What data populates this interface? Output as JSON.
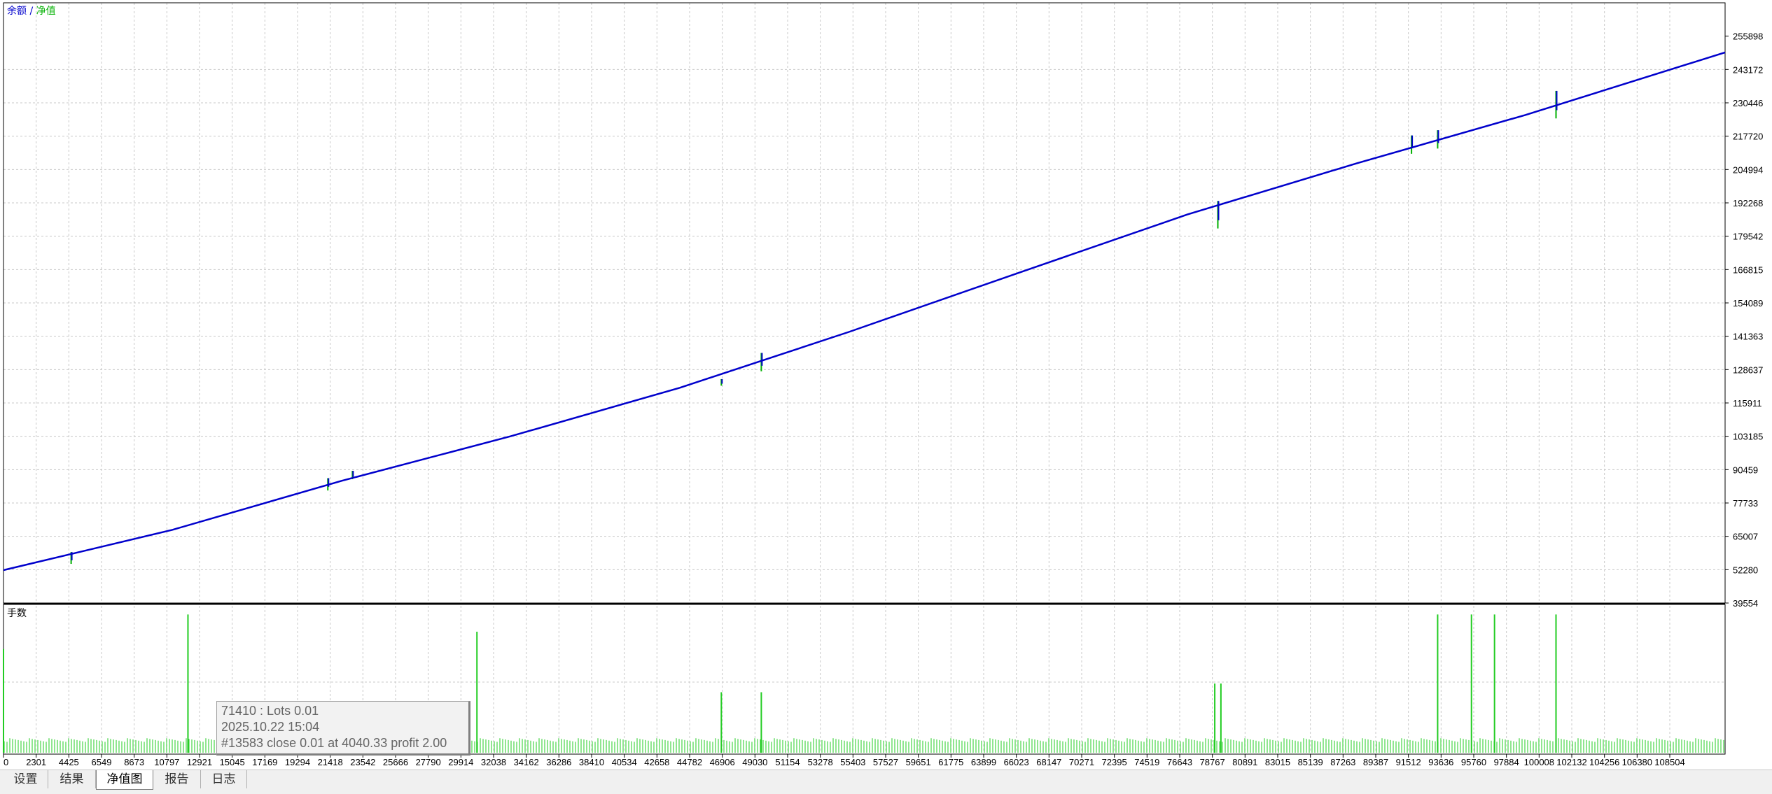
{
  "legend": {
    "balance_label": "余额",
    "separator": " / ",
    "equity_label": "净值",
    "balance_color": "#0000cc",
    "equity_color": "#00b000"
  },
  "lower_pane": {
    "title": "手数"
  },
  "tooltip": {
    "line1": "71410 : Lots 0.01",
    "line2": "2025.10.22 15:04",
    "line3": "#13583 close 0.01 at 4040.33 profit 2.00"
  },
  "tabs": [
    {
      "label": "设置",
      "active": false
    },
    {
      "label": "结果",
      "active": false
    },
    {
      "label": "净值图",
      "active": true
    },
    {
      "label": "报告",
      "active": false
    },
    {
      "label": "日志",
      "active": false
    }
  ],
  "chart_data": {
    "type": "line",
    "y_ticks": [
      255898,
      243172,
      230446,
      217720,
      204994,
      192268,
      179542,
      166815,
      154089,
      141363,
      128637,
      115911,
      103185,
      90459,
      77733,
      65007,
      52280,
      39554
    ],
    "x_ticks": [
      "0",
      "2301",
      "4425",
      "6549",
      "8673",
      "10797",
      "12921",
      "15045",
      "17169",
      "19294",
      "21418",
      "23542",
      "25666",
      "27790",
      "29914",
      "32038",
      "34162",
      "36286",
      "38410",
      "40534",
      "42658",
      "44782",
      "46906",
      "49030",
      "51154",
      "53278",
      "55403",
      "57527",
      "59651",
      "61775",
      "63899",
      "66023",
      "68147",
      "70271",
      "72395",
      "74519",
      "76643",
      "78767",
      "80891",
      "83015",
      "85139",
      "87263",
      "89387",
      "91512",
      "93636",
      "95760",
      "97884",
      "100008",
      "102132",
      "104256",
      "106380",
      "108504"
    ],
    "x_range": [
      0,
      112000
    ],
    "ylim": [
      39554,
      268624
    ],
    "grid": true,
    "series": [
      {
        "name": "余额",
        "color": "#0000cc",
        "x": [
          0,
          11000,
          22000,
          33000,
          44000,
          55000,
          66000,
          77000,
          88000,
          99000,
          112000
        ],
        "y": [
          52100,
          67500,
          86200,
          103200,
          121700,
          143000,
          165500,
          187800,
          207300,
          225800,
          249700
        ]
      }
    ],
    "equity_spikes": [
      {
        "x": 22700,
        "low": 86800,
        "high": 90000
      },
      {
        "x": 21100,
        "low": 82500,
        "high": 87200
      },
      {
        "x": 4400,
        "low": 54500,
        "high": 59000
      },
      {
        "x": 46700,
        "low": 122500,
        "high": 125000
      },
      {
        "x": 49300,
        "low": 128000,
        "high": 135000
      },
      {
        "x": 79000,
        "low": 182500,
        "high": 193000
      },
      {
        "x": 91600,
        "low": 211000,
        "high": 218000
      },
      {
        "x": 93300,
        "low": 213000,
        "high": 220000
      },
      {
        "x": 101000,
        "low": 224500,
        "high": 235000
      }
    ],
    "lots_spikes": [
      {
        "x": 0,
        "lots": 0.06
      },
      {
        "x": 12000,
        "lots": 0.08
      },
      {
        "x": 30800,
        "lots": 0.07
      },
      {
        "x": 46700,
        "lots": 0.035
      },
      {
        "x": 49300,
        "lots": 0.035
      },
      {
        "x": 78800,
        "lots": 0.04
      },
      {
        "x": 79200,
        "lots": 0.04
      },
      {
        "x": 93300,
        "lots": 0.08
      },
      {
        "x": 95500,
        "lots": 0.08
      },
      {
        "x": 97000,
        "lots": 0.08
      },
      {
        "x": 101000,
        "lots": 0.08
      }
    ],
    "lots_base": 0.01
  }
}
